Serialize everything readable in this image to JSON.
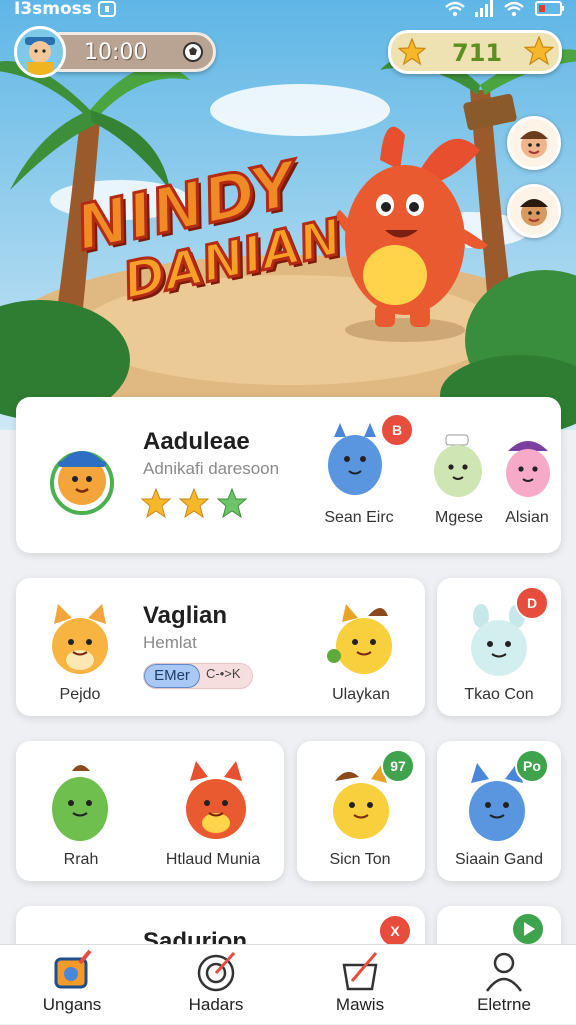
{
  "status_bar": {
    "carrier": "Ι3smoss"
  },
  "profile": {
    "score": "10:00"
  },
  "stars": {
    "count": "711"
  },
  "hero": {
    "logo_line1": "NINDY",
    "logo_line2": "DANIAN"
  },
  "featured": {
    "title": "Aaduleae",
    "subtitle": "Adnikafi daresoon",
    "rating_stars": 3,
    "characters": [
      {
        "name": "Sean Eirc",
        "badge": "B"
      },
      {
        "name": "Mgese"
      },
      {
        "name": "Alsian"
      }
    ]
  },
  "row2": {
    "title": "Vaglian",
    "subtitle": "Hemlat",
    "chip_primary": "EMer",
    "chip_secondary": "C-•>K",
    "characters": [
      {
        "name": "Pejdo"
      },
      {
        "name": "Ulaykan"
      },
      {
        "name": "Tkao Con",
        "badge": "D"
      }
    ]
  },
  "row3": {
    "characters": [
      {
        "name": "Rrah"
      },
      {
        "name": "Htlaud Munia"
      },
      {
        "name": "Sicn Ton",
        "badge": "97"
      },
      {
        "name": "Siaain Gand",
        "badge": "Po"
      }
    ]
  },
  "row4": {
    "title": "Sadurion",
    "badge": "X"
  },
  "tabs": [
    {
      "label": "Ungans",
      "icon": "game-icon"
    },
    {
      "label": "Hadars",
      "icon": "target-icon"
    },
    {
      "label": "Mawis",
      "icon": "basket-icon"
    },
    {
      "label": "Eletrne",
      "icon": "person-icon"
    }
  ],
  "colors": {
    "accent": "#e85a2a",
    "star": "#f6b82a",
    "badge_red": "#e74c3c",
    "badge_green": "#3fa34d",
    "chip_blue": "#a9c8f4"
  }
}
